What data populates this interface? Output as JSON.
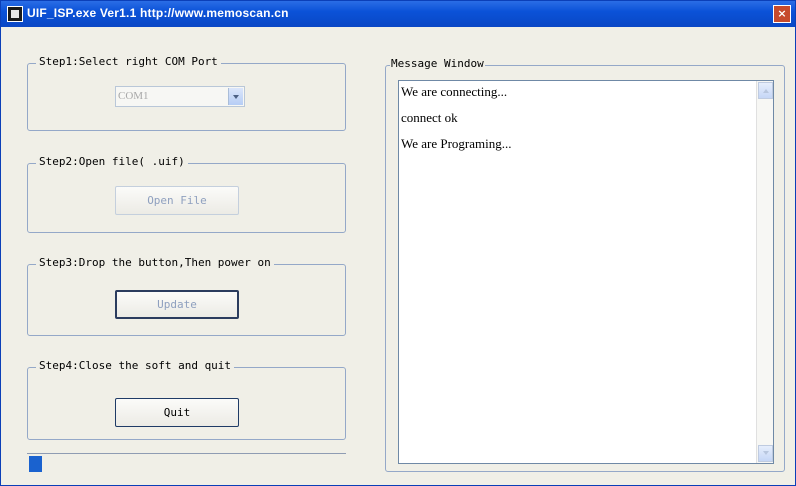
{
  "window": {
    "title": "UIF_ISP.exe  Ver1.1  http://www.memoscan.cn",
    "close_glyph": "×"
  },
  "step1": {
    "label": "Step1:Select right COM Port",
    "com_port": "COM1"
  },
  "step2": {
    "label": "Step2:Open file( .uif)",
    "button": "Open File"
  },
  "step3": {
    "label": "Step3:Drop the button,Then power on",
    "button": "Update"
  },
  "step4": {
    "label": "Step4:Close the soft and quit",
    "button": "Quit"
  },
  "progress": {
    "fraction": 0.04
  },
  "message_window": {
    "label": "Message Window",
    "lines": [
      "We are connecting...",
      "connect ok",
      "We are Programing..."
    ]
  },
  "colors": {
    "titlebar": "#0b52d8",
    "progress_fill": "#1a62cf",
    "group_border": "#94a8c8"
  }
}
